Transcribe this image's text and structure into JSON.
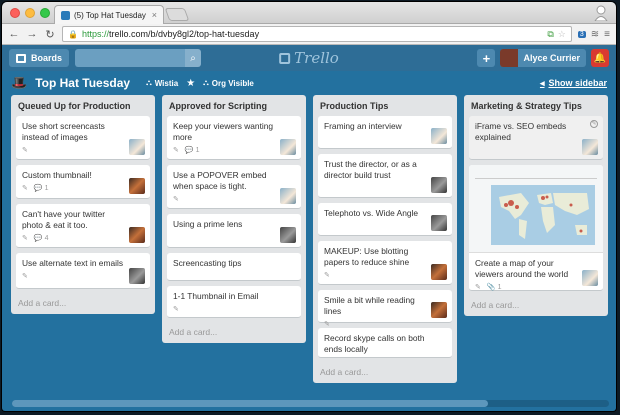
{
  "browser": {
    "tab_title": "(5) Top Hat Tuesday | Trel",
    "url_scheme": "https://",
    "url_rest": "trello.com/b/dvby8gl2/top-hat-tuesday",
    "extension_badge": "3"
  },
  "header": {
    "boards_label": "Boards",
    "logo_text": "Trello",
    "member_name": "Alyce Currier"
  },
  "board": {
    "title": "Top Hat Tuesday",
    "org": "Wistia",
    "visibility": "Org Visible",
    "show_sidebar": "Show sidebar"
  },
  "lists": [
    {
      "title": "Queued Up for Production",
      "add_card": "Add a card...",
      "cards": [
        {
          "text": "Use short screencasts instead of images",
          "comments": ""
        },
        {
          "text": "Custom thumbnail!",
          "comments": "1"
        },
        {
          "text": "Can't have your twitter photo & eat it too.",
          "comments": "4"
        },
        {
          "text": "Use alternate text in emails",
          "comments": ""
        }
      ]
    },
    {
      "title": "Approved for Scripting",
      "add_card": "Add a card...",
      "cards": [
        {
          "text": "Keep your viewers wanting more",
          "comments": "1"
        },
        {
          "text": "Use a POPOVER embed when space is tight.",
          "comments": ""
        },
        {
          "text": "Using a prime lens",
          "comments": ""
        },
        {
          "text": "Screencasting tips",
          "comments": ""
        },
        {
          "text": "1-1 Thumbnail in Email",
          "comments": ""
        }
      ]
    },
    {
      "title": "Production Tips",
      "add_card": "Add a card...",
      "cards": [
        {
          "text": "Framing an interview",
          "comments": ""
        },
        {
          "text": "Trust the director, or as a director build trust",
          "comments": ""
        },
        {
          "text": "Telephoto vs. Wide Angle",
          "comments": ""
        },
        {
          "text": "MAKEUP: Use blotting papers to reduce shine",
          "comments": ""
        },
        {
          "text": "Smile a bit while reading lines",
          "comments": ""
        },
        {
          "text": "Record skype calls on both ends locally",
          "comments": ""
        }
      ]
    },
    {
      "title": "Marketing & Strategy Tips",
      "add_card": "Add a card...",
      "cards": [
        {
          "text": "iFrame vs. SEO embeds explained",
          "comments": ""
        },
        {
          "text": "Create a map of your viewers around the world",
          "attachments": "1"
        }
      ]
    }
  ]
}
